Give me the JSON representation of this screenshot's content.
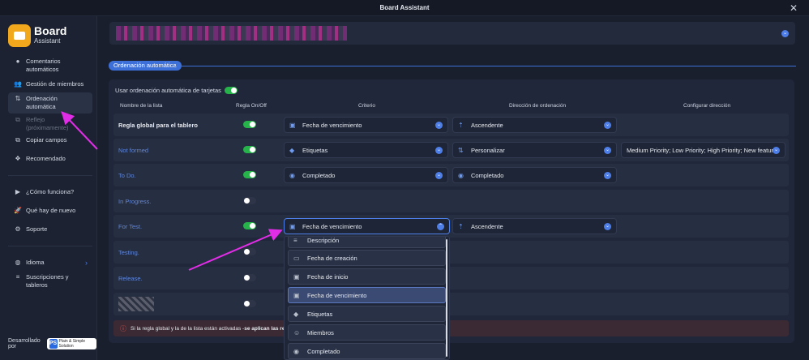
{
  "window": {
    "title": "Board Assistant"
  },
  "logo": {
    "line1": "Board",
    "line2": "Assistant"
  },
  "sidebar": {
    "items": [
      {
        "label": "Comentarios automáticos",
        "icon": "comment-icon"
      },
      {
        "label": "Gestión de miembros",
        "icon": "members-icon"
      },
      {
        "label": "Ordenación automática",
        "icon": "sort-icon",
        "active": true
      },
      {
        "label": "Reflejo (próximamente)",
        "icon": "mirror-icon",
        "disabled": true
      },
      {
        "label": "Copiar campos",
        "icon": "copy-icon"
      },
      {
        "label": "Recomendado",
        "icon": "recommended-icon"
      },
      {
        "label": "¿Cómo funciona?",
        "icon": "youtube-icon"
      },
      {
        "label": "Qué hay de nuevo",
        "icon": "rocket-icon"
      },
      {
        "label": "Soporte",
        "icon": "support-icon"
      },
      {
        "label": "Idioma",
        "icon": "globe-icon"
      },
      {
        "label": "Suscripciones y tableros",
        "icon": "subscriptions-icon"
      }
    ],
    "developed_by": "Desarrollado por",
    "brand_logo": "Plain & Simple Solution"
  },
  "section": {
    "title": "Ordenación automática"
  },
  "auto_sort": {
    "label": "Usar ordenación automática de tarjetas",
    "enabled": true
  },
  "table": {
    "headers": {
      "list_name": "Nombre de la lista",
      "rule": "Regla On/Off",
      "criterion": "Criterio",
      "direction": "Dirección de ordenación",
      "configure": "Configurar dirección"
    },
    "rows": [
      {
        "name": "Regla global para el tablero",
        "on": true,
        "criterion": "Fecha de vencimiento",
        "criterion_icon": "due-date-icon",
        "direction": "Ascendente",
        "direction_icon": "sort-asc-icon"
      },
      {
        "name": "Not formed",
        "on": true,
        "criterion": "Etiquetas",
        "criterion_icon": "tag-icon",
        "direction": "Personalizar",
        "direction_icon": "custom-sort-icon",
        "configure": "Medium Priority; Low Priority; High Priority; New featur..."
      },
      {
        "name": "To Do.",
        "on": true,
        "criterion": "Completado",
        "criterion_icon": "completed-icon",
        "direction": "Completado",
        "direction_icon": "completed-icon"
      },
      {
        "name": "In Progress.",
        "on": false
      },
      {
        "name": "For Test.",
        "on": true,
        "criterion": "Fecha de vencimiento",
        "criterion_icon": "due-date-icon",
        "direction": "Ascendente",
        "direction_icon": "sort-asc-icon"
      },
      {
        "name": "Testing.",
        "on": false
      },
      {
        "name": "Release.",
        "on": false
      },
      {
        "name": "",
        "on": false
      }
    ]
  },
  "info": {
    "text": "Si la regla global y la de la lista están activadas - ",
    "bold": "se aplican las regla"
  },
  "dropdown": {
    "items": [
      {
        "label": "Descripción",
        "icon": "description-icon"
      },
      {
        "label": "Fecha de creación",
        "icon": "created-date-icon"
      },
      {
        "label": "Fecha de inicio",
        "icon": "start-date-icon"
      },
      {
        "label": "Fecha de vencimiento",
        "icon": "due-date-icon",
        "selected": true
      },
      {
        "label": "Etiquetas",
        "icon": "tag-icon"
      },
      {
        "label": "Miembros",
        "icon": "member-icon"
      },
      {
        "label": "Completado",
        "icon": "completed-icon"
      }
    ]
  },
  "colors": {
    "accent": "#3d6fd9",
    "toggle_on": "#25b34a",
    "arrow": "#e12de6"
  }
}
